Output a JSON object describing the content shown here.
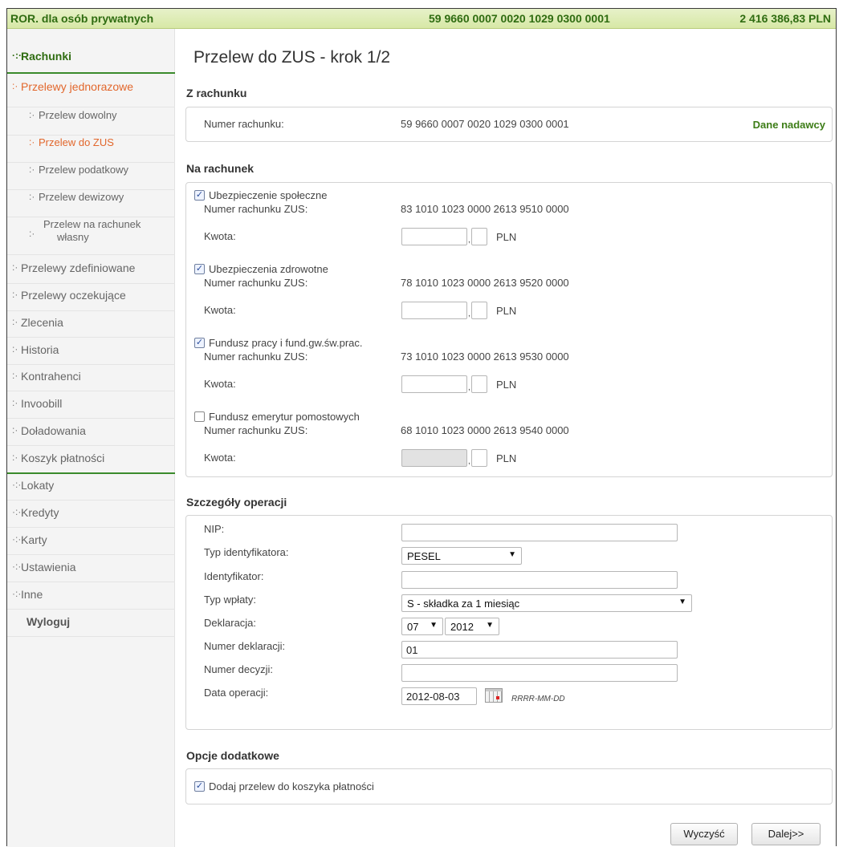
{
  "topbar": {
    "account_name": "ROR. dla osób prywatnych",
    "account_number": "59 9660 0007 0020 1029 0300 0001",
    "balance": "2 416 386,83 PLN"
  },
  "sidebar": {
    "rachunki": "Rachunki",
    "przelewy_jednorazowe": "Przelewy jednorazowe",
    "sub": {
      "dowolny": "Przelew dowolny",
      "zus": "Przelew do ZUS",
      "podatkowy": "Przelew podatkowy",
      "dewizowy": "Przelew dewizowy",
      "wlasny_1": "Przelew na rachunek",
      "wlasny_2": "własny"
    },
    "zdefiniowane": "Przelewy zdefiniowane",
    "oczekujace": "Przelewy oczekujące",
    "zlecenia": "Zlecenia",
    "historia": "Historia",
    "kontrahenci": "Kontrahenci",
    "invoobill": "Invoobill",
    "doladowania": "Doładowania",
    "koszyk": "Koszyk płatności",
    "lokaty": "Lokaty",
    "kredyty": "Kredyty",
    "karty": "Karty",
    "ustawienia": "Ustawienia",
    "inne": "Inne",
    "wyloguj": "Wyloguj"
  },
  "page": {
    "title": "Przelew do ZUS - krok 1/2"
  },
  "from": {
    "section": "Z rachunku",
    "label": "Numer rachunku:",
    "number": "59 9660 0007 0020 1029 0300 0001",
    "link": "Dane nadawcy"
  },
  "to": {
    "section": "Na rachunek",
    "acc_label": "Numer rachunku ZUS:",
    "amount_label": "Kwota:",
    "currency": "PLN",
    "items": [
      {
        "name": "Ubezpieczenie społeczne",
        "checked": true,
        "number": "83 1010 1023 0000 2613 9510 0000"
      },
      {
        "name": "Ubezpieczenia zdrowotne",
        "checked": true,
        "number": "78 1010 1023 0000 2613 9520 0000"
      },
      {
        "name": "Fundusz pracy i fund.gw.św.prac.",
        "checked": true,
        "number": "73 1010 1023 0000 2613 9530 0000"
      },
      {
        "name": "Fundusz emerytur pomostowych",
        "checked": false,
        "number": "68 1010 1023 0000 2613 9540 0000"
      }
    ]
  },
  "details": {
    "section": "Szczegóły operacji",
    "nip_label": "NIP:",
    "typ_id_label": "Typ identyfikatora:",
    "typ_id_value": "PESEL",
    "id_label": "Identyfikator:",
    "typ_wplaty_label": "Typ wpłaty:",
    "typ_wplaty_value": "S - składka za 1 miesiąc",
    "deklaracja_label": "Deklaracja:",
    "deklaracja_month": "07",
    "deklaracja_year": "2012",
    "nr_deklaracji_label": "Numer deklaracji:",
    "nr_deklaracji_value": "01",
    "nr_decyzji_label": "Numer decyzji:",
    "data_label": "Data operacji:",
    "data_value": "2012-08-03",
    "data_hint": "RRRR-MM-DD"
  },
  "options": {
    "section": "Opcje dodatkowe",
    "basket_label": "Dodaj przelew do koszyka płatności",
    "basket_checked": true
  },
  "buttons": {
    "clear": "Wyczyść",
    "next": "Dalej>>"
  },
  "colors": {
    "green": "#2f6c11",
    "orange": "#e2672c",
    "topbar_bg": "#d7e8a6"
  }
}
